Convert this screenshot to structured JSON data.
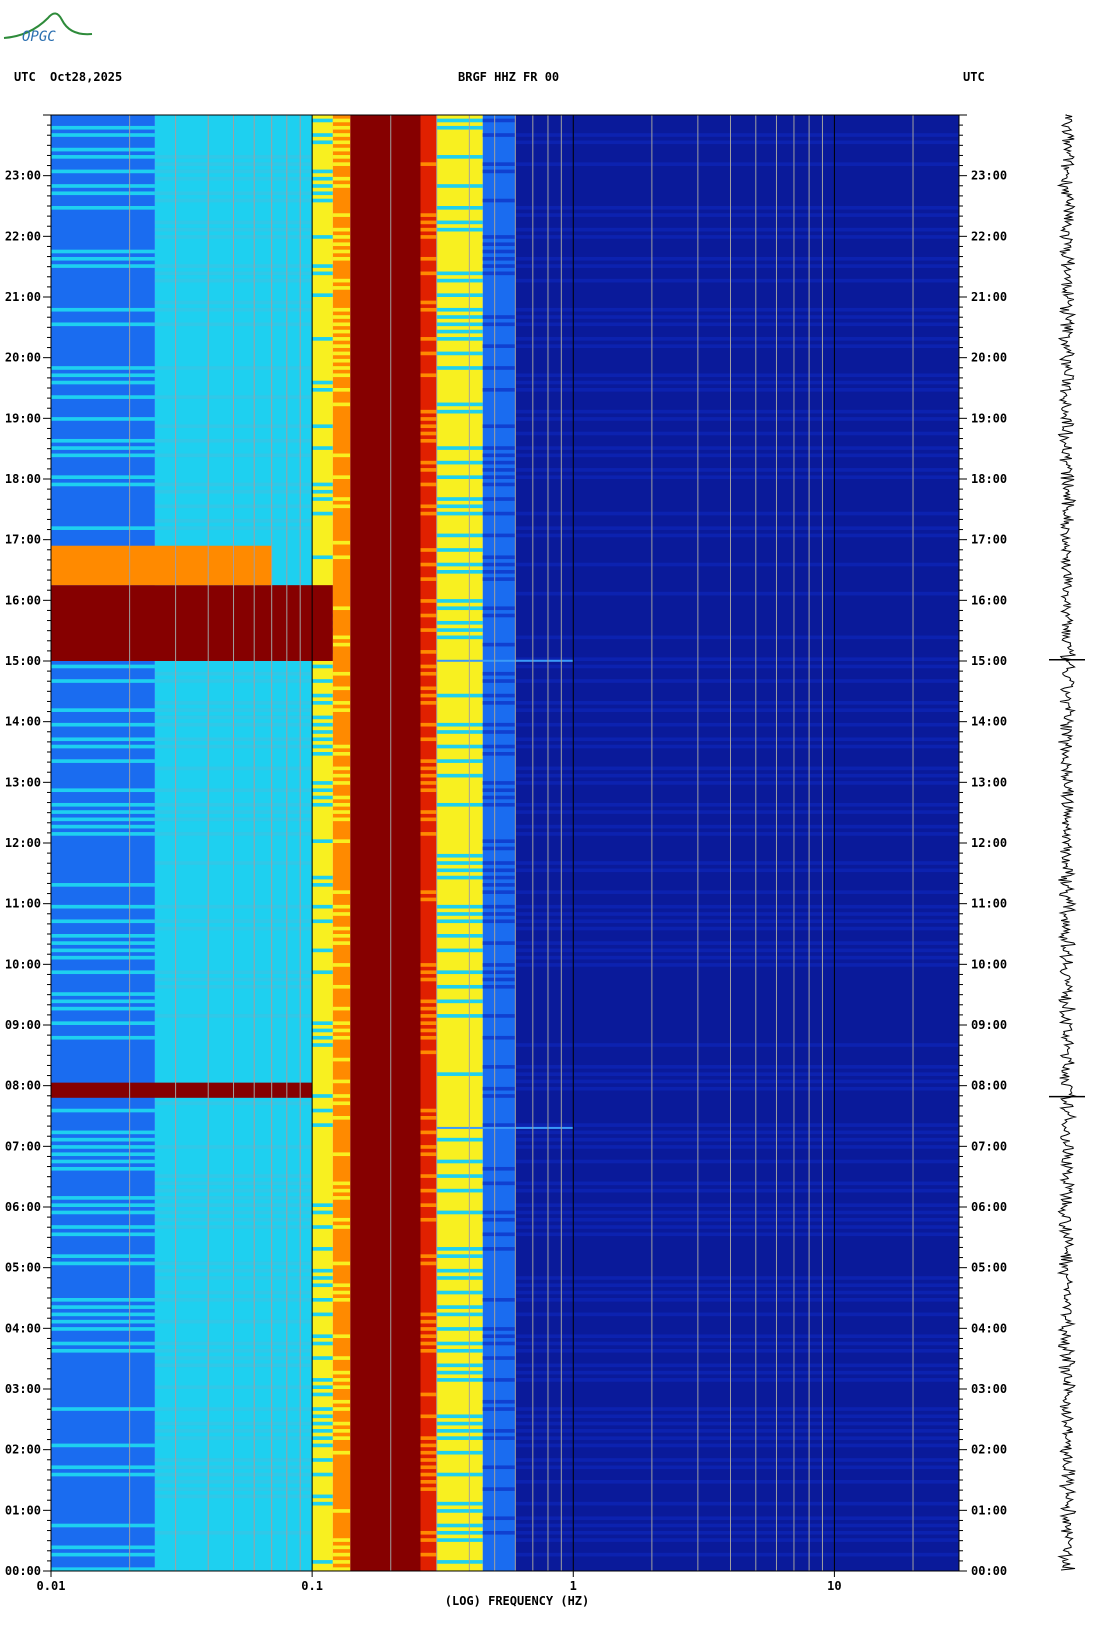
{
  "header": {
    "logo_text": "OPGC",
    "utc_left": "UTC",
    "date": "Oct28,2025",
    "station": "BRGF HHZ FR 00",
    "utc_right": "UTC"
  },
  "colors": {
    "low": "#0a1a9a",
    "mid_blue": "#1a6cf0",
    "cyan": "#1ed0f0",
    "yellow": "#f8f020",
    "orange": "#ff8a00",
    "red": "#e02000",
    "dark_red": "#860000",
    "trace": "#000000"
  },
  "chart_data": {
    "type": "heatmap",
    "xlabel": "(LOG) FREQUENCY (HZ)",
    "x_scale": "log",
    "xlim_hz": [
      0.01,
      30
    ],
    "x_ticks": [
      {
        "value": 0.01,
        "label": "0.01"
      },
      {
        "value": 0.1,
        "label": "0.1"
      },
      {
        "value": 1,
        "label": "1"
      },
      {
        "value": 10,
        "label": "10"
      }
    ],
    "ylim_hours": [
      0,
      24
    ],
    "y_ticks": [
      "00:00",
      "01:00",
      "02:00",
      "03:00",
      "04:00",
      "05:00",
      "06:00",
      "07:00",
      "08:00",
      "09:00",
      "10:00",
      "11:00",
      "12:00",
      "13:00",
      "14:00",
      "15:00",
      "16:00",
      "17:00",
      "18:00",
      "19:00",
      "20:00",
      "21:00",
      "22:00",
      "23:00"
    ],
    "spectral_bands_hz": [
      {
        "from": 0.01,
        "to": 0.025,
        "level": "cyan-blue"
      },
      {
        "from": 0.025,
        "to": 0.1,
        "level": "cyan"
      },
      {
        "from": 0.1,
        "to": 0.12,
        "level": "yellow"
      },
      {
        "from": 0.12,
        "to": 0.14,
        "level": "orange"
      },
      {
        "from": 0.14,
        "to": 0.26,
        "level": "dark red"
      },
      {
        "from": 0.26,
        "to": 0.3,
        "level": "red-orange"
      },
      {
        "from": 0.3,
        "to": 0.45,
        "level": "yellow-cyan"
      },
      {
        "from": 0.45,
        "to": 0.6,
        "level": "blue"
      },
      {
        "from": 0.6,
        "to": 30,
        "level": "dark blue"
      }
    ],
    "events": [
      {
        "start_hour": 15.0,
        "end_hour": 16.25,
        "max_freq_hz": 0.12,
        "description": "high energy band"
      },
      {
        "start_hour": 7.8,
        "end_hour": 8.05,
        "max_freq_hz": 0.1,
        "description": "high energy band"
      },
      {
        "start_hour": 16.25,
        "end_hour": 16.9,
        "max_freq_hz": 0.07,
        "description": "moderate energy band"
      },
      {
        "start_hour": 15.0,
        "end_hour": 15.02,
        "max_freq_hz": 1.0,
        "description": "short broadband spike"
      },
      {
        "start_hour": 7.3,
        "end_hour": 7.32,
        "max_freq_hz": 1.0,
        "description": "short broadband spike"
      }
    ]
  }
}
